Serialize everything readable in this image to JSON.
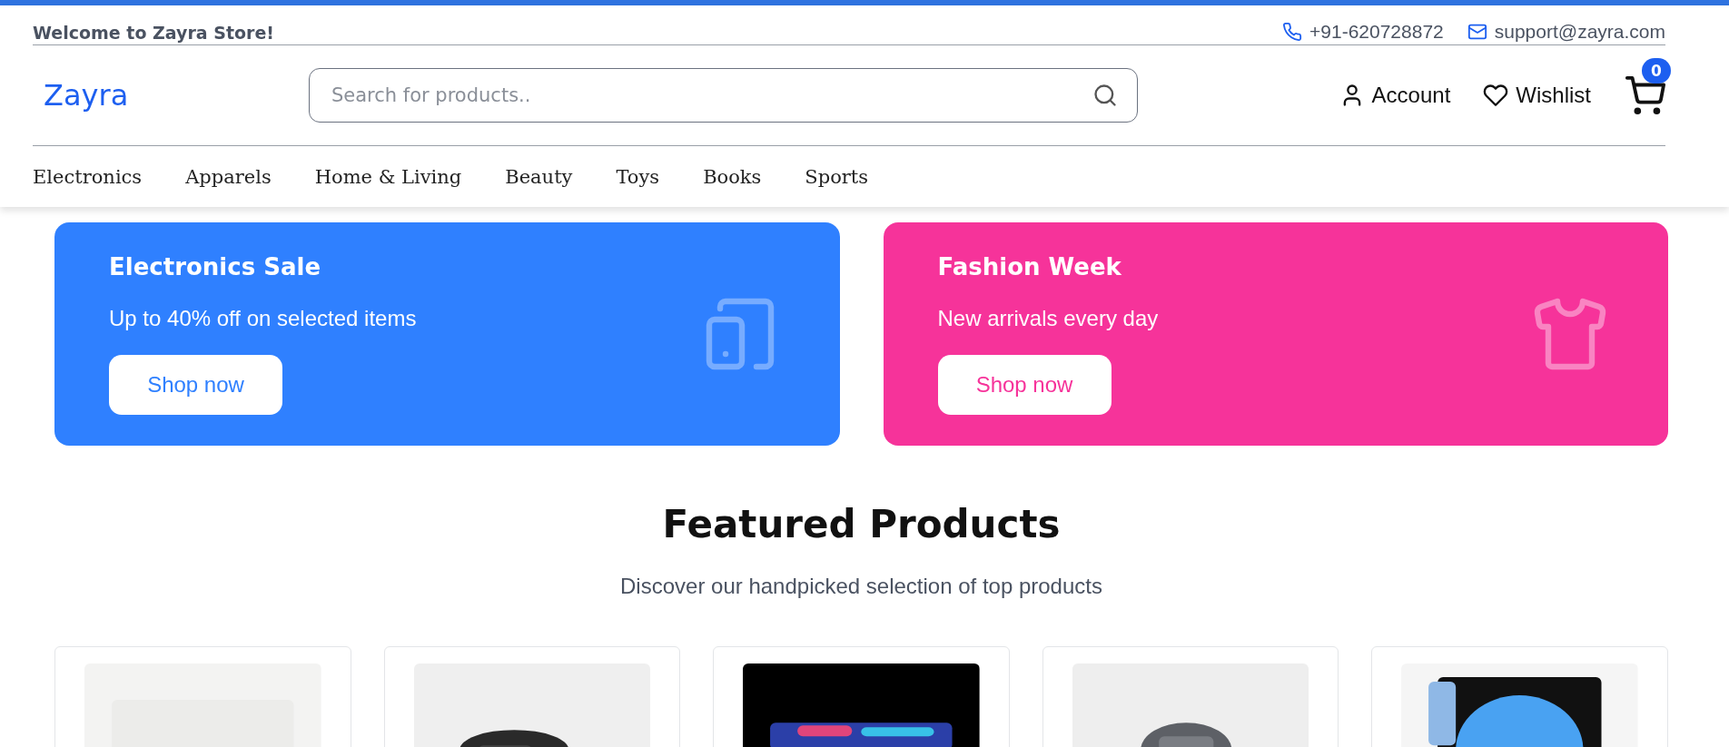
{
  "topbar": {
    "welcome": "Welcome to Zayra Store!",
    "phone": "+91-620728872",
    "email": "support@zayra.com"
  },
  "header": {
    "logo": "Zayra",
    "search": {
      "placeholder": "Search for products.."
    },
    "account": "Account",
    "wishlist": "Wishlist",
    "cart_count": "0"
  },
  "nav": [
    "Electronics",
    "Apparels",
    "Home & Living",
    "Beauty",
    "Toys",
    "Books",
    "Sports"
  ],
  "banners": [
    {
      "kind": "tablet",
      "title": "Electronics Sale",
      "text": "Up to 40% off on selected items",
      "button": "Shop now",
      "color": "#2f80ff"
    },
    {
      "kind": "shirt",
      "title": "Fashion Week",
      "text": "New arrivals every day",
      "button": "Shop now",
      "color": "#f6339a"
    }
  ],
  "featured": {
    "title": "Featured Products",
    "subtitle": "Discover our handpicked selection of top products"
  }
}
